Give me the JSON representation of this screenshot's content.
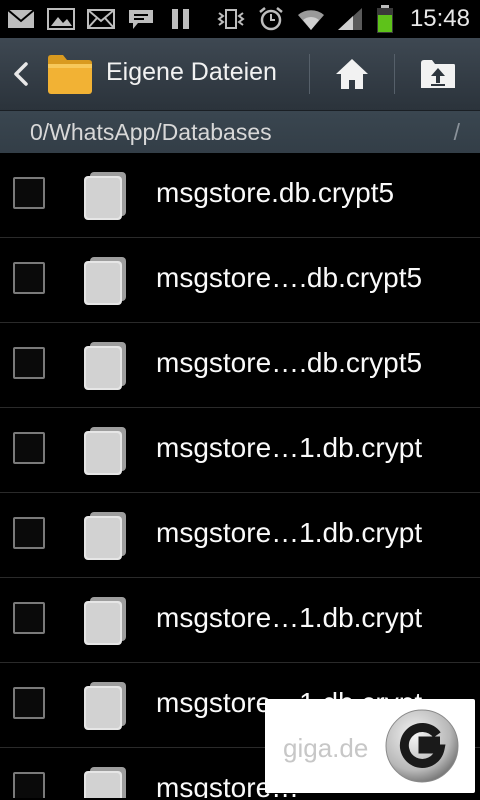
{
  "status_bar": {
    "time": "15:48",
    "left_icons": [
      "mail-icon",
      "gallery-icon",
      "envelope-icon",
      "chat-icon",
      "pause-icon"
    ],
    "right_icons": [
      "vibrate-icon",
      "alarm-icon",
      "wifi-icon",
      "signal-icon",
      "battery-icon"
    ],
    "battery_color": "#5ec21a"
  },
  "action_bar": {
    "title": "Eigene Dateien",
    "folder_color": "#f2b234"
  },
  "path_bar": {
    "clipped_prefix": "/",
    "path": "0/WhatsApp/Databases",
    "trailing": "/"
  },
  "files": [
    {
      "name": "msgstore.db.crypt5"
    },
    {
      "name": "msgstore….db.crypt5"
    },
    {
      "name": "msgstore….db.crypt5"
    },
    {
      "name": "msgstore…1.db.crypt"
    },
    {
      "name": "msgstore…1.db.crypt"
    },
    {
      "name": "msgstore…1.db.crypt"
    },
    {
      "name": "msgstore…1.db.crypt"
    },
    {
      "name": "msgstore…"
    }
  ],
  "watermark": {
    "text": "giga.de"
  }
}
